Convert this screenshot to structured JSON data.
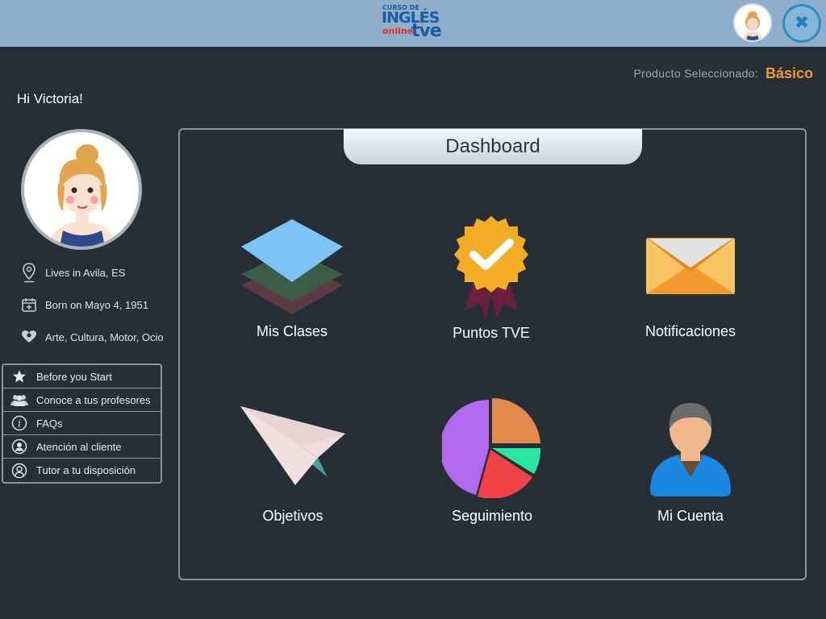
{
  "header": {
    "logo": {
      "line1": "CURSO DE",
      "line2": "INGLÉS",
      "line3": "online",
      "line4": "tve"
    },
    "avatar_icon": "user-avatar-icon",
    "close_icon": "close-icon",
    "close_symbol": "✖"
  },
  "product": {
    "label": "Producto Seleccionado:",
    "value": "Básico"
  },
  "greeting": "Hi Victoria!",
  "profile": {
    "location": "Lives in Avila, ES",
    "birth": "Born on Mayo 4, 1951",
    "interests": "Arte, Cultura, Motor, Ocio"
  },
  "menu": [
    {
      "label": "Before you Start",
      "icon": "star-icon"
    },
    {
      "label": "Conoce a tus profesores",
      "icon": "group-icon"
    },
    {
      "label": "FAQs",
      "icon": "info-icon"
    },
    {
      "label": "Atención al cliente",
      "icon": "user-circle-icon"
    },
    {
      "label": "Tutor a tu disposición",
      "icon": "tutor-icon"
    }
  ],
  "dashboard": {
    "title": "Dashboard",
    "tiles": [
      {
        "label": "Mis Clases",
        "icon": "layers-icon"
      },
      {
        "label": "Puntos TVE",
        "icon": "badge-icon"
      },
      {
        "label": "Notificaciones",
        "icon": "envelope-icon"
      },
      {
        "label": "Objetivos",
        "icon": "paper-plane-icon"
      },
      {
        "label": "Seguimiento",
        "icon": "pie-chart-icon"
      },
      {
        "label": "Mi Cuenta",
        "icon": "account-icon"
      }
    ]
  },
  "colors": {
    "topbar": "#8eaecb",
    "background": "#262f35",
    "accent_orange": "#f19a2c",
    "brand_blue": "#1c5ca6"
  }
}
